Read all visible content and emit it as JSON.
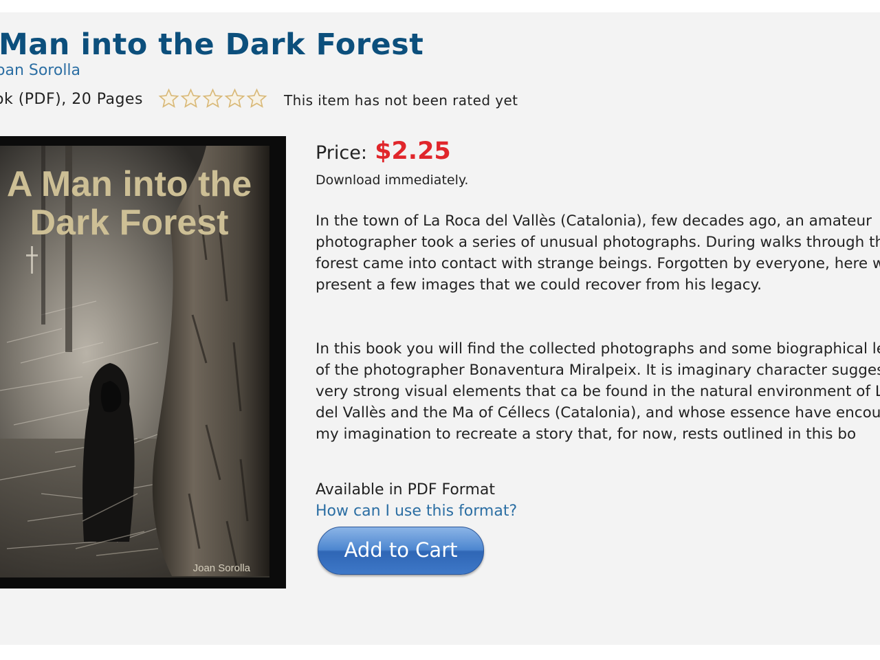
{
  "product": {
    "title": "Man into the Dark Forest",
    "author": "oan Sorolla",
    "format_pages": "ok (PDF), 20 Pages",
    "rating": {
      "value": 0,
      "max": 5,
      "text": "This item has not been rated yet"
    }
  },
  "cover": {
    "title_line1": "A Man into the",
    "title_line2": "Dark Forest",
    "author": "Joan Sorolla"
  },
  "purchase": {
    "price_label": "Price:",
    "price": "$2.25",
    "download": "Download immediately.",
    "available": "Available in PDF Format",
    "howto_link": "How can I use this format?",
    "cart_button": "Add to Cart"
  },
  "description": {
    "paragraph1": "In the town of La Roca del Vallès (Catalonia), few decades ago, an amateur photographer took a series of unusual photographs. During walks through the forest came into contact with strange beings. Forgotten by everyone, here we present a few images that we could recover from his legacy.",
    "paragraph2": "In this book you will find the collected photographs and some biographical legacy of the photographer Bonaventura Miralpeix. It is imaginary character suggested by very strong visual elements that ca be found in the natural environment of La Roca del Vallès and the Ma of Céllecs (Catalonia), and whose essence have encouraged my imagination to recreate a story that, for now, rests outlined in this bo"
  },
  "colors": {
    "title": "#0c4f7c",
    "link": "#2b6ea3",
    "price": "#e0262b",
    "button": "#3e78c8",
    "star_outline": "#d9b978"
  },
  "icons": [
    "star-icon"
  ]
}
